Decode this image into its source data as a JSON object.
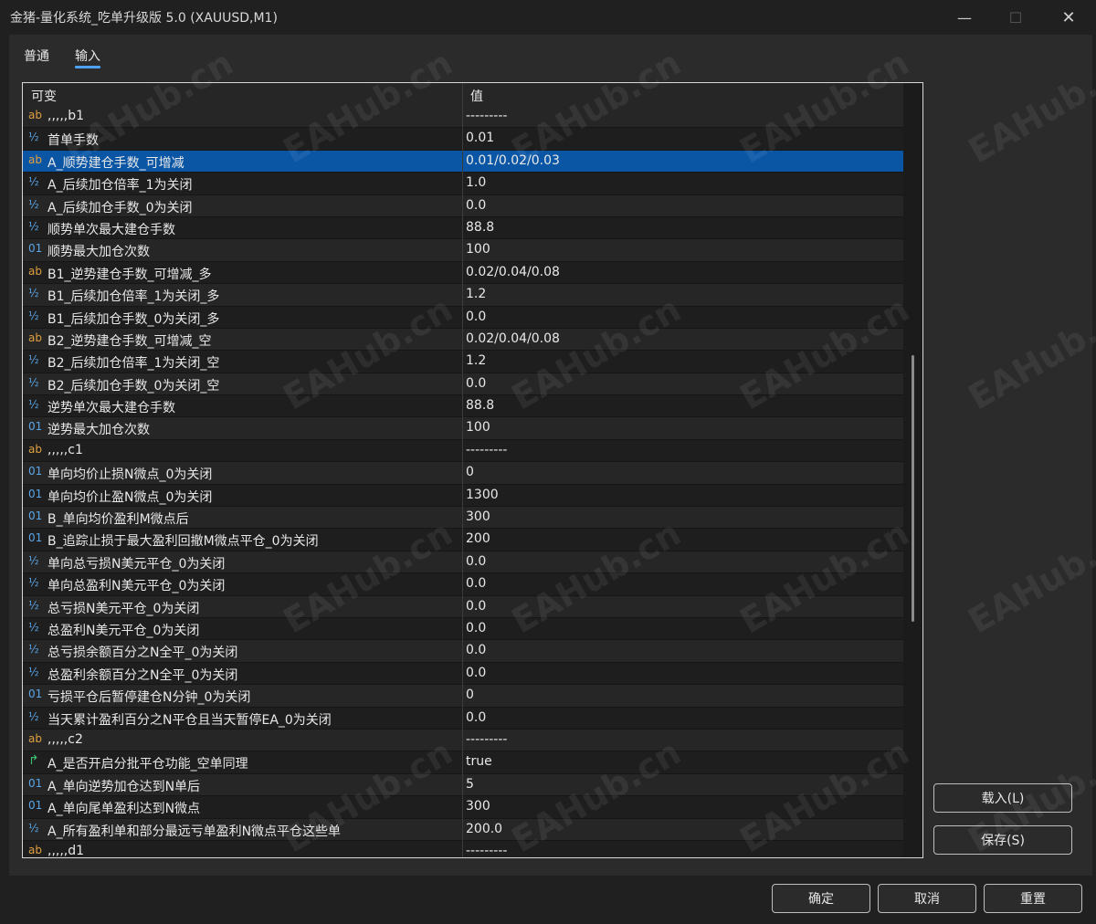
{
  "window": {
    "title": "金猪-量化系统_吃单升级版 5.0 (XAUUSD,M1)",
    "min_glyph": "—",
    "max_glyph": "☐",
    "close_glyph": "✕"
  },
  "tabs": [
    {
      "label": "普通"
    },
    {
      "label": "输入"
    }
  ],
  "table": {
    "col_variable": "可变",
    "col_value": "值",
    "rows": [
      {
        "type": "ab",
        "name": ",,,,,b1",
        "value": "---------"
      },
      {
        "type": "half",
        "name": "首单手数",
        "value": "0.01"
      },
      {
        "type": "ab",
        "name": "A_顺势建仓手数_可增减",
        "value": "0.01/0.02/0.03",
        "selected": true
      },
      {
        "type": "half",
        "name": "A_后续加仓倍率_1为关闭",
        "value": "1.0"
      },
      {
        "type": "half",
        "name": "A_后续加仓手数_0为关闭",
        "value": "0.0"
      },
      {
        "type": "half",
        "name": "顺势单次最大建仓手数",
        "value": "88.8"
      },
      {
        "type": "int",
        "name": "顺势最大加仓次数",
        "value": "100"
      },
      {
        "type": "ab",
        "name": "B1_逆势建仓手数_可增减_多",
        "value": "0.02/0.04/0.08"
      },
      {
        "type": "half",
        "name": "B1_后续加仓倍率_1为关闭_多",
        "value": "1.2"
      },
      {
        "type": "half",
        "name": "B1_后续加仓手数_0为关闭_多",
        "value": "0.0"
      },
      {
        "type": "ab",
        "name": "B2_逆势建仓手数_可增减_空",
        "value": "0.02/0.04/0.08"
      },
      {
        "type": "half",
        "name": "B2_后续加仓倍率_1为关闭_空",
        "value": "1.2"
      },
      {
        "type": "half",
        "name": "B2_后续加仓手数_0为关闭_空",
        "value": "0.0"
      },
      {
        "type": "half",
        "name": "逆势单次最大建仓手数",
        "value": "88.8"
      },
      {
        "type": "int",
        "name": "逆势最大加仓次数",
        "value": "100"
      },
      {
        "type": "ab",
        "name": ",,,,,c1",
        "value": "---------"
      },
      {
        "type": "int",
        "name": "单向均价止损N微点_0为关闭",
        "value": "0"
      },
      {
        "type": "int",
        "name": "单向均价止盈N微点_0为关闭",
        "value": "1300"
      },
      {
        "type": "int",
        "name": "B_单向均价盈利M微点后",
        "value": "300"
      },
      {
        "type": "int",
        "name": "B_追踪止损于最大盈利回撤M微点平仓_0为关闭",
        "value": "200"
      },
      {
        "type": "half",
        "name": "单向总亏损N美元平仓_0为关闭",
        "value": "0.0"
      },
      {
        "type": "half",
        "name": "单向总盈利N美元平仓_0为关闭",
        "value": "0.0"
      },
      {
        "type": "half",
        "name": "总亏损N美元平仓_0为关闭",
        "value": "0.0"
      },
      {
        "type": "half",
        "name": "总盈利N美元平仓_0为关闭",
        "value": "0.0"
      },
      {
        "type": "half",
        "name": "总亏损余额百分之N全平_0为关闭",
        "value": "0.0"
      },
      {
        "type": "half",
        "name": "总盈利余额百分之N全平_0为关闭",
        "value": "0.0"
      },
      {
        "type": "int",
        "name": "亏损平仓后暂停建仓N分钟_0为关闭",
        "value": "0"
      },
      {
        "type": "half",
        "name": "当天累计盈利百分之N平仓且当天暂停EA_0为关闭",
        "value": "0.0"
      },
      {
        "type": "ab",
        "name": ",,,,,c2",
        "value": "---------"
      },
      {
        "type": "bool",
        "name": "A_是否开启分批平仓功能_空单同理",
        "value": "true"
      },
      {
        "type": "int",
        "name": "A_单向逆势加仓达到N单后",
        "value": "5"
      },
      {
        "type": "int",
        "name": "A_单向尾单盈利达到N微点",
        "value": "300"
      },
      {
        "type": "half",
        "name": "A_所有盈利单和部分最远亏单盈利N微点平仓这些单",
        "value": "200.0"
      },
      {
        "type": "ab",
        "name": ",,,,,d1",
        "value": "---------"
      }
    ]
  },
  "icons": {
    "ab": "ab",
    "half": "½",
    "int": "01",
    "bool": "↱"
  },
  "buttons": {
    "load": "载入(L)",
    "save": "保存(S)",
    "ok": "确定",
    "cancel": "取消",
    "reset": "重置"
  },
  "watermark": "EAHub.cn"
}
